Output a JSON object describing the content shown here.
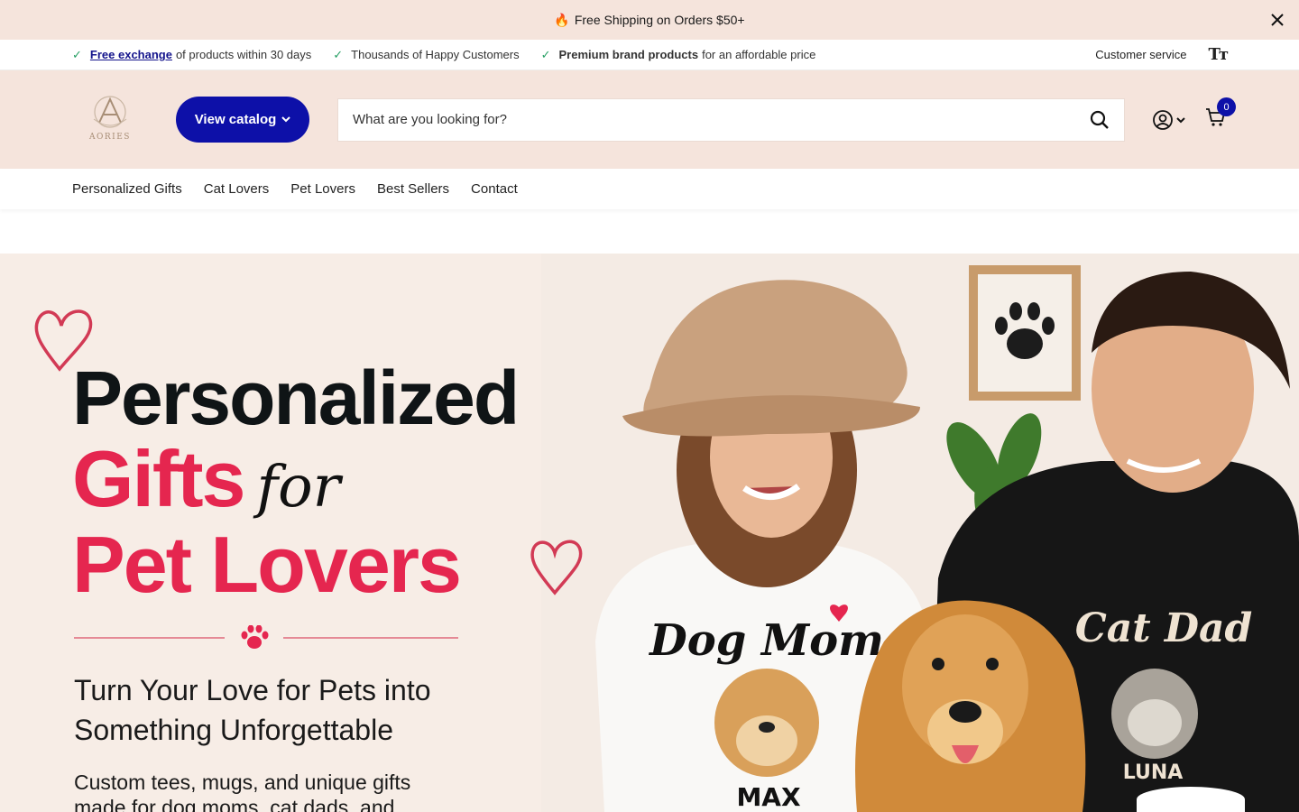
{
  "announcement": {
    "text": "Free Shipping on Orders $50+",
    "icon": "fire-icon",
    "close_icon": "close-icon"
  },
  "usp": {
    "items": [
      {
        "link": "Free exchange",
        "text": "of products within 30 days"
      },
      {
        "text": "Thousands of Happy Customers"
      },
      {
        "bold": "Premium brand products",
        "text": "for an affordable price"
      }
    ],
    "customer_service": "Customer service",
    "text_size_icon": "Tт"
  },
  "header": {
    "logo_text": "AORIES",
    "catalog_label": "View catalog",
    "search_placeholder": "What are you looking for?",
    "cart_count": "0"
  },
  "nav": {
    "items": [
      "Personalized Gifts",
      "Cat Lovers",
      "Pet Lovers",
      "Best Sellers",
      "Contact"
    ]
  },
  "hero": {
    "line1": "Personalized",
    "line2": "Gifts",
    "for": "for",
    "line3": "Pet Lovers",
    "subtitle_line1": "Turn Your Love for Pets into",
    "subtitle_line2": "Something Unforgettable",
    "body_line1": "Custom tees, mugs, and unique gifts",
    "body_line2": "made for dog moms, cat dads, and",
    "shirt_left_text": "Dog Mom",
    "shirt_left_name": "MAX",
    "shirt_right_text": "Cat Dad",
    "shirt_right_name": "LUNA"
  },
  "colors": {
    "brand_blue": "#0d10a8",
    "accent_pink": "#e5264f",
    "header_bg": "#f5e4dc",
    "check_green": "#28a065"
  }
}
